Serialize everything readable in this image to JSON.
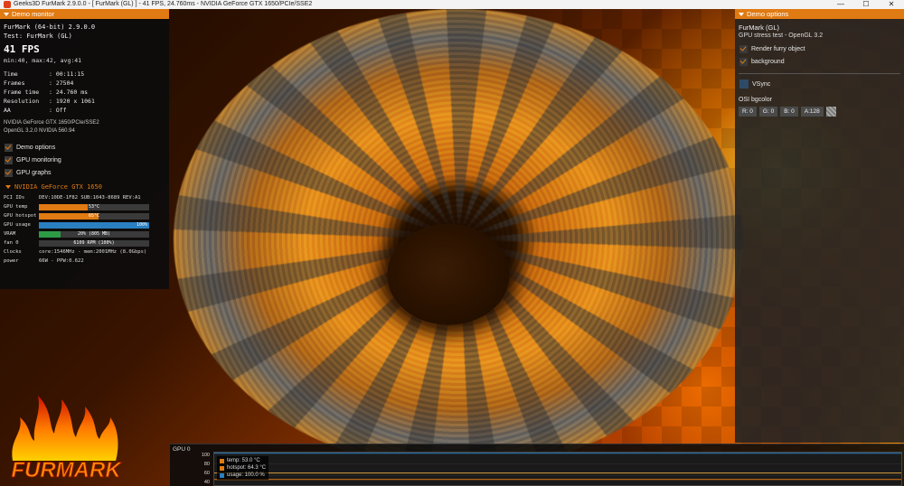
{
  "window": {
    "title": "Geeks3D FurMark 2.9.0.0 - [ FurMark (GL) ] - 41 FPS, 24.760ms - NVIDIA GeForce GTX 1650/PCIe/SSE2",
    "min_glyph": "—",
    "max_glyph": "☐",
    "close_glyph": "✕"
  },
  "monitor": {
    "header": "Demo monitor",
    "app_line": "FurMark (64-bit) 2.9.0.0",
    "test_line": "Test: FurMark (GL)",
    "fps": "41 FPS",
    "minmax": "min:40, max:42, avg:41",
    "stats": [
      {
        "k": "Time",
        "v": ": 00:11:15"
      },
      {
        "k": "Frames",
        "v": ": 27504"
      },
      {
        "k": "Frame time",
        "v": ": 24.760 ms"
      },
      {
        "k": "Resolution",
        "v": ": 1920 x 1061"
      },
      {
        "k": "AA",
        "v": ": Off"
      }
    ],
    "gpu_line1": "NVIDIA GeForce GTX 1650/PCIe/SSE2",
    "gpu_line2": "OpenGL 3.2.0 NVIDIA 560.94",
    "checkboxes": [
      {
        "label": "Demo options",
        "checked": true
      },
      {
        "label": "GPU monitoring",
        "checked": true
      },
      {
        "label": "GPU graphs",
        "checked": true
      }
    ],
    "gpu_name": "NVIDIA GeForce GTX 1650",
    "pci_k": "PCI IDs",
    "pci_v": "DEV:10DE-1F82 SUB:1043-8689 REV:A1",
    "bars": [
      {
        "k": "GPU temp",
        "label": "53°C",
        "level": 0.44,
        "color": "#e07a12"
      },
      {
        "k": "GPU hotspot",
        "label": "65°C",
        "level": 0.54,
        "color": "#e07a12"
      },
      {
        "k": "GPU usage",
        "label": "100%",
        "level": 1.0,
        "color": "#2a7fc0"
      },
      {
        "k": "VRAM",
        "label": "20% (805 MB)",
        "level": 0.2,
        "color": "#2d9a46"
      },
      {
        "k": "fan 0",
        "label": "6109 RPM (100%)",
        "level": 1.0,
        "color": "#3a3a3a"
      }
    ],
    "clocks_k": "Clocks",
    "clocks_v": "core:1546MHz - mem:2001MHz (8.0Gbps)",
    "power_k": "power",
    "power_v": "66W - PPW:0.622",
    "logo_text": "FURMARK"
  },
  "options": {
    "header": "Demo options",
    "line1": "FurMark (GL)",
    "line2": "GPU stress test - OpenGL 3.2",
    "checkboxes": [
      {
        "label": "Render furry object",
        "checked": true
      },
      {
        "label": "background",
        "checked": true
      }
    ],
    "vsync_label": "VSync",
    "osi_label": "OSI bgcolor",
    "osi_fields": [
      "R: 0",
      "G: 0",
      "B: 0",
      "A:128"
    ]
  },
  "graph": {
    "title": "GPU 0",
    "ticks": [
      "100",
      "80",
      "60",
      "40"
    ],
    "legend": [
      {
        "label": "temp: 53.0 °C",
        "color": "#e07a12"
      },
      {
        "label": "hotspot: 64.3 °C",
        "color": "#e07a12"
      },
      {
        "label": "usage: 100.0 %",
        "color": "#2a7fc0"
      }
    ],
    "series": [
      {
        "name": "temp: 53.0 °C",
        "value": 53.0,
        "color": "#e07a12"
      },
      {
        "name": "hotspot: 64.3 °C",
        "value": 64.3,
        "color": "#d8a040"
      },
      {
        "name": "usage: 100.0 %",
        "value": 100.0,
        "color": "#2a7fc0"
      }
    ],
    "y_range": [
      40,
      100
    ]
  }
}
